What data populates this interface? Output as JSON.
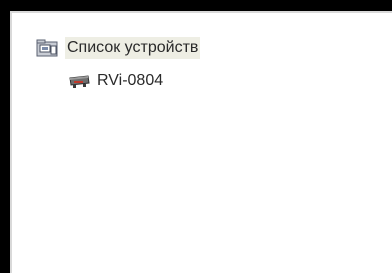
{
  "tree": {
    "root": {
      "label": "Список устройств",
      "icon": "device-list-folder-icon"
    },
    "children": [
      {
        "label": "RVi-0804",
        "icon": "dvr-recorder-icon"
      }
    ]
  },
  "colors": {
    "frame": "#000000",
    "panel_border": "#d9d9d9",
    "selection_bg": "#eeeee4",
    "text": "#2a2a2a"
  }
}
